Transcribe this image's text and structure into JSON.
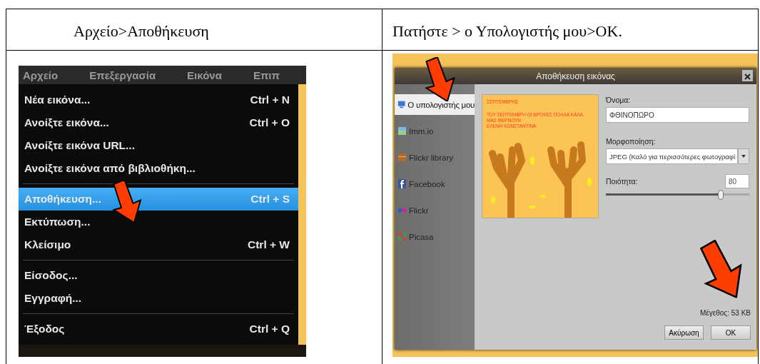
{
  "left_heading": "Αρχείο>Αποθήκευση",
  "right_heading": "Πατήστε > ο Υπολογιστής μου>OK.",
  "menu_screenshot": {
    "menubar": [
      "Αρχείο",
      "Επεξεργασία",
      "Εικόνα",
      "Επιπ"
    ],
    "items": [
      {
        "kind": "item",
        "label": "Νέα εικόνα...",
        "shortcut": "Ctrl + N",
        "selected": false
      },
      {
        "kind": "item",
        "label": "Ανοίξτε εικόνα...",
        "shortcut": "Ctrl + O",
        "selected": false
      },
      {
        "kind": "item",
        "label": "Ανοίξτε εικόνα URL...",
        "selected": false
      },
      {
        "kind": "item",
        "label": "Ανοίξτε εικόνα από βιβλιοθήκη...",
        "selected": false
      },
      {
        "kind": "separator"
      },
      {
        "kind": "item",
        "label": "Αποθήκευση...",
        "shortcut": "Ctrl + S",
        "selected": true
      },
      {
        "kind": "item",
        "label": "Εκτύπωση...",
        "selected": false
      },
      {
        "kind": "item",
        "label": "Κλείσιμο",
        "shortcut": "Ctrl + W",
        "selected": false
      },
      {
        "kind": "separator"
      },
      {
        "kind": "item",
        "label": "Είσοδος...",
        "selected": false
      },
      {
        "kind": "item",
        "label": "Εγγραφή...",
        "selected": false
      },
      {
        "kind": "separator"
      },
      {
        "kind": "item",
        "label": "Έξοδος",
        "shortcut": "Ctrl + Q",
        "selected": false
      }
    ]
  },
  "save_dialog": {
    "title": "Αποθήκευση εικόνας",
    "destinations": [
      {
        "label": "Ο υπολογιστής μου",
        "selected": true
      },
      {
        "label": "Imm.io",
        "selected": false
      },
      {
        "label": "Flickr library",
        "selected": false
      },
      {
        "label": "Facebook",
        "selected": false
      },
      {
        "label": "Flickr",
        "selected": false
      },
      {
        "label": "Picasa",
        "selected": false
      }
    ],
    "preview_text": [
      "ΣΕΠΤΕΜΒΡΗΣ",
      "ΤΟΥ ΣΕΠΤΕΜΒΡΗ ΟΙ ΒΡΟΧΕΣ ΠΟΛΛΑ ΚΑΛΑ ΜΑΣ ΦΕΡΝΟΥΝ",
      "ΕΛΕΝΗ ΚΩΝΣΤΑΝΤΙΝΑ"
    ],
    "name_label": "Όνομα:",
    "name_value": "ΦΘΙΝΟΠΩΡΟ",
    "format_label": "Μορφοποίηση:",
    "format_value": "JPEG (Καλό για περισσότερες φωτογραφί",
    "quality_label": "Ποιότητα:",
    "quality_value": "80",
    "quality": {
      "level": 0.8
    },
    "size": "Μέγεθος: 53 KB",
    "buttons": [
      "Ακύρωση",
      "OK"
    ]
  }
}
